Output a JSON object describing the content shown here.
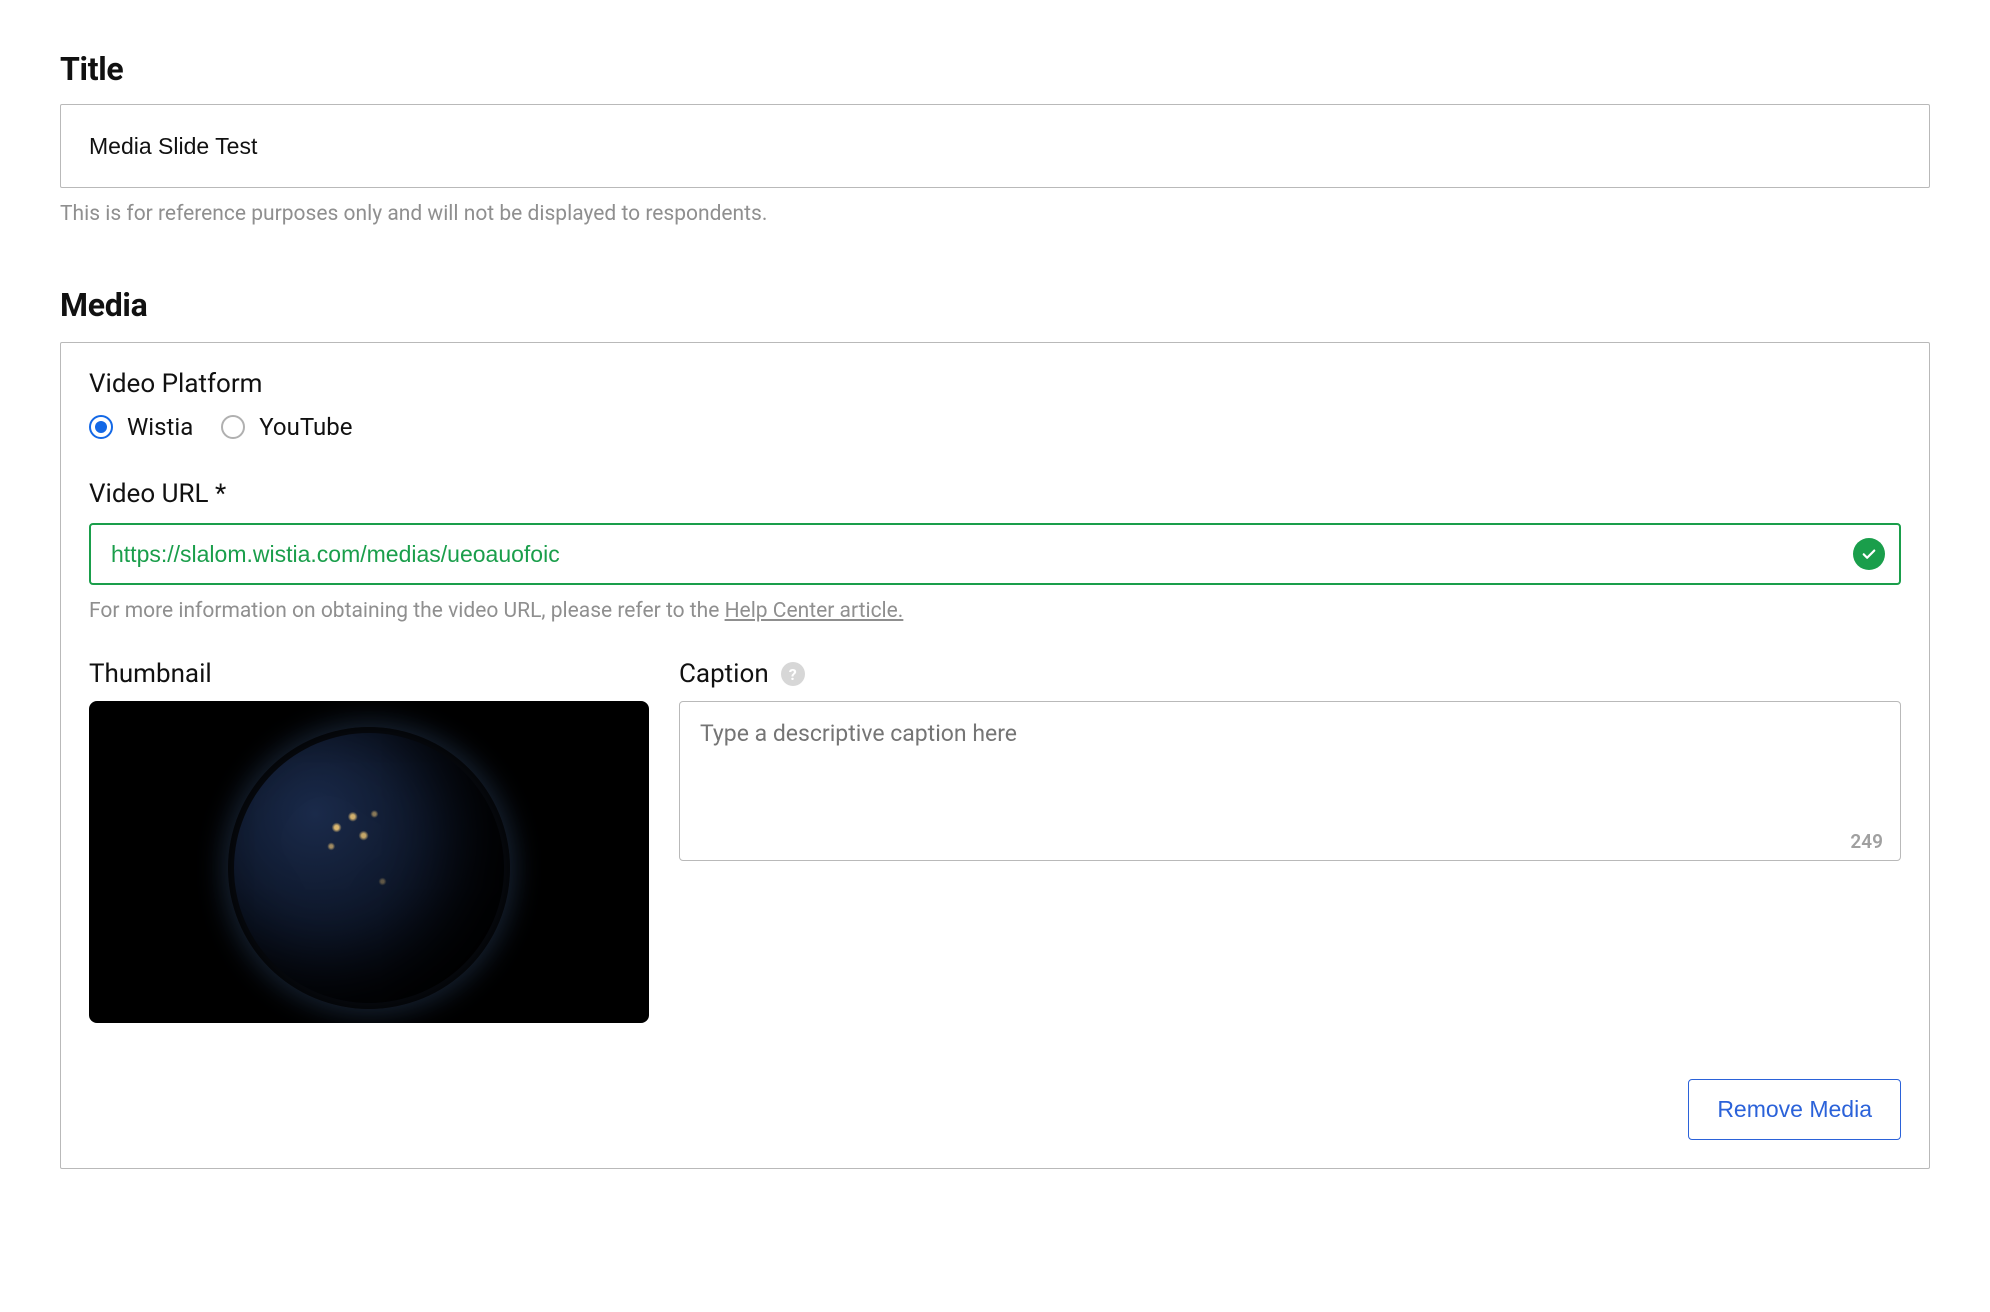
{
  "title": {
    "heading": "Title",
    "value": "Media Slide Test",
    "help": "This is for reference purposes only and will not be displayed to respondents."
  },
  "media": {
    "heading": "Media",
    "platform": {
      "label": "Video Platform",
      "options": [
        "Wistia",
        "YouTube"
      ],
      "selected": "Wistia"
    },
    "url": {
      "label": "Video URL *",
      "value": "https://slalom.wistia.com/medias/ueoauofoic",
      "valid": true,
      "help_prefix": "For more information on obtaining the video URL, please refer to the ",
      "help_link": "Help Center article."
    },
    "thumbnail": {
      "label": "Thumbnail"
    },
    "caption": {
      "label": "Caption",
      "placeholder": "Type a descriptive caption here",
      "value": "",
      "charCount": "249"
    },
    "removeButton": "Remove Media"
  }
}
